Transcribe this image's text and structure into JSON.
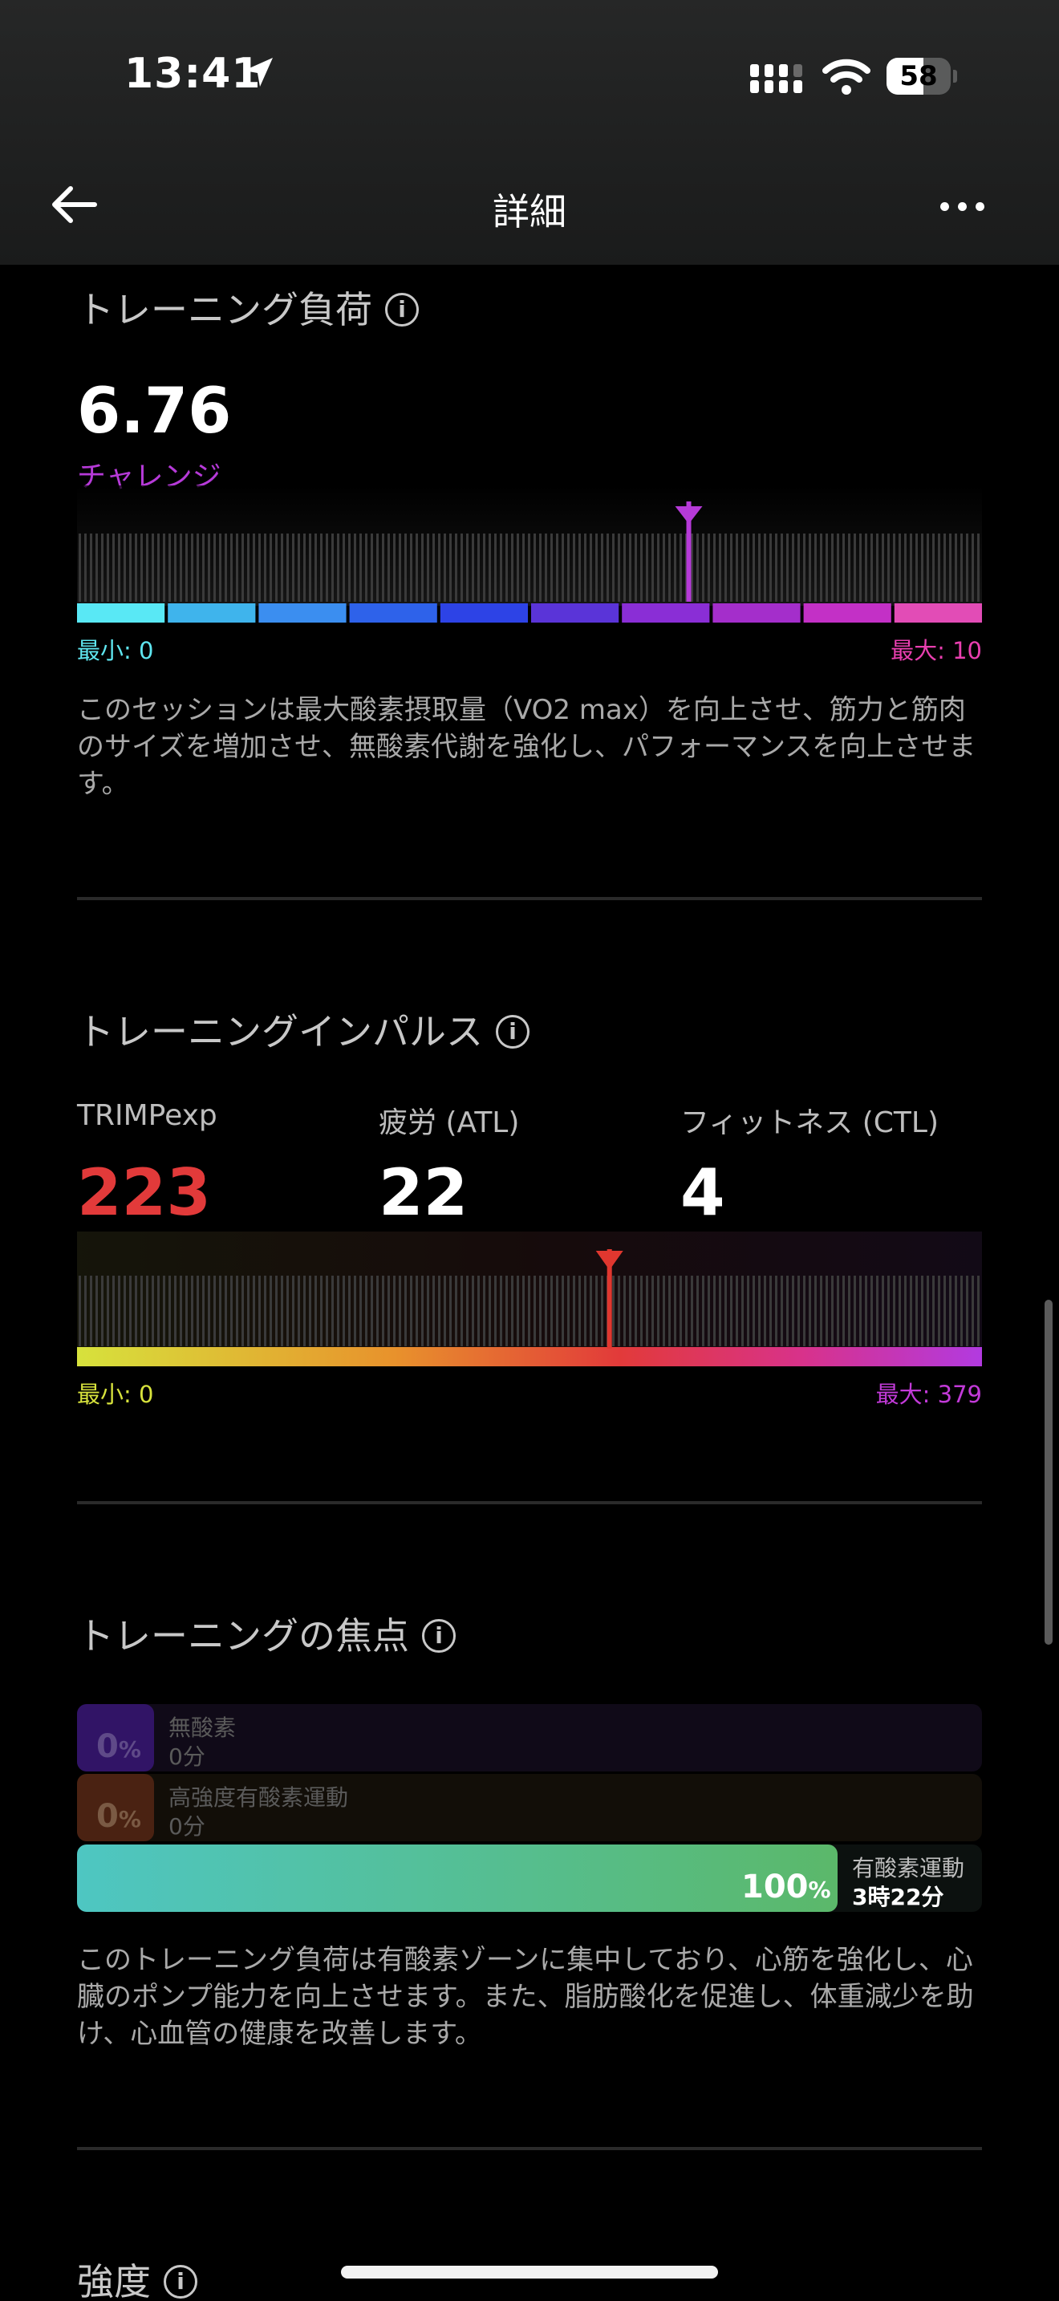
{
  "status": {
    "time": "13:41",
    "battery": "58",
    "battery_level": 0.58
  },
  "nav": {
    "title": "詳細"
  },
  "training_load": {
    "title": "トレーニング負荷",
    "value": "6.76",
    "level": "チャレンジ",
    "min_label": "最小: 0",
    "max_label": "最大: 10",
    "min": 0,
    "max": 10,
    "description": "このセッションは最大酸素摂取量（VO2 max）を向上させ、筋力と筋肉のサイズを増加させ、無酸素代謝を強化し、パフォーマンスを向上させます。",
    "colors": {
      "level": "#b63ad8",
      "max": "#e93fb0",
      "min": "#5fe6f0"
    },
    "segment_colors": [
      "#59e8f5",
      "#3fb4ec",
      "#3b8ef0",
      "#2e62ea",
      "#2d43e6",
      "#5a34d8",
      "#8a2ed6",
      "#a42ecb",
      "#c330c6",
      "#e24cb6"
    ]
  },
  "training_impulse": {
    "title": "トレーニングインパルス",
    "metrics": [
      {
        "label": "TRIMPexp",
        "value": "223",
        "color": "#e23a3a"
      },
      {
        "label": "疲労 (ATL)",
        "value": "22",
        "color": "#ffffff"
      },
      {
        "label": "フィットネス (CTL)",
        "value": "4",
        "color": "#ffffff"
      }
    ],
    "min_label": "最小: 0",
    "max_label": "最大: 379",
    "min": 0,
    "max": 379,
    "marker_value": 223,
    "colors": {
      "min": "#d7e23c",
      "max": "#c23ad8",
      "marker": "#e0372f"
    }
  },
  "training_focus": {
    "title": "トレーニングの焦点",
    "rows": [
      {
        "pct": "0",
        "unit": "%",
        "name": "無酸素",
        "time": "0分",
        "fraction": 0,
        "color": "#3a1670"
      },
      {
        "pct": "0",
        "unit": "%",
        "name": "高強度有酸素運動",
        "time": "0分",
        "fraction": 0,
        "color": "#4a2614"
      },
      {
        "pct": "100",
        "unit": "%",
        "name": "有酸素運動",
        "time": "3時22分",
        "fraction": 1.0,
        "color": "#4fc6a6"
      }
    ],
    "description": "このトレーニング負荷は有酸素ゾーンに集中しており、心筋を強化し、心臓のポンプ能力を向上させます。また、脂肪酸化を促進し、体重減少を助け、心血管の健康を改善します。"
  },
  "intensity": {
    "title": "強度"
  },
  "icons": [
    "location-arrow-icon",
    "cellular-signal-icon",
    "wifi-icon",
    "battery-icon",
    "back-arrow-icon",
    "more-icon",
    "info-icon"
  ]
}
